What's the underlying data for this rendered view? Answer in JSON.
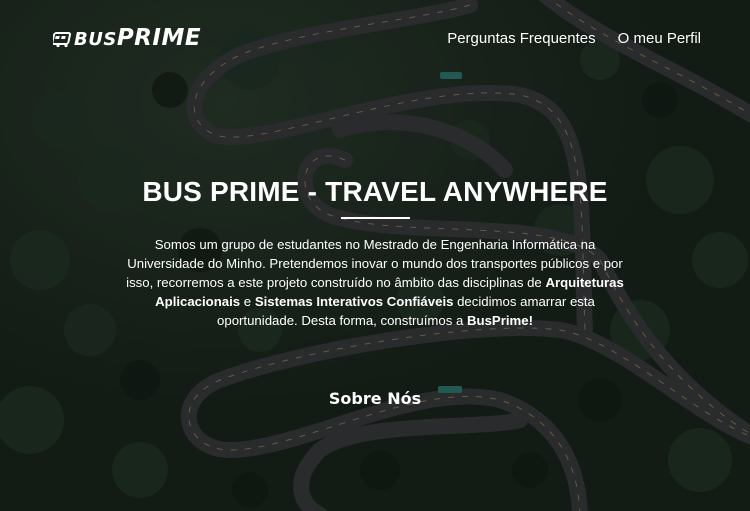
{
  "brand": {
    "logo_prefix": "BUS",
    "logo_suffix": "PRIME"
  },
  "nav": {
    "items": [
      {
        "label": "Perguntas Frequentes"
      },
      {
        "label": "O meu Perfil"
      }
    ]
  },
  "hero": {
    "title": "BUS PRIME - TRAVEL ANYWHERE",
    "description": {
      "part1": "Somos um grupo de estudantes no Mestrado de Engenharia Informática na Universidade do Minho. Pretendemos inovar o mundo dos transportes públicos e por isso, recorremos a este projeto construído no âmbito das disciplinas de ",
      "course1": "Arquiteturas Aplicacionais",
      "part2": " e ",
      "course2": "Sistemas Interativos Confiáveis",
      "part3": " decidimos amarrar esta oportunidade. Desta forma, construímos a ",
      "brand": "BusPrime!"
    },
    "about_label": "Sobre Nós"
  },
  "colors": {
    "forest": "#1d2a21",
    "road": "#3b3d3e",
    "text": "#ffffff"
  }
}
